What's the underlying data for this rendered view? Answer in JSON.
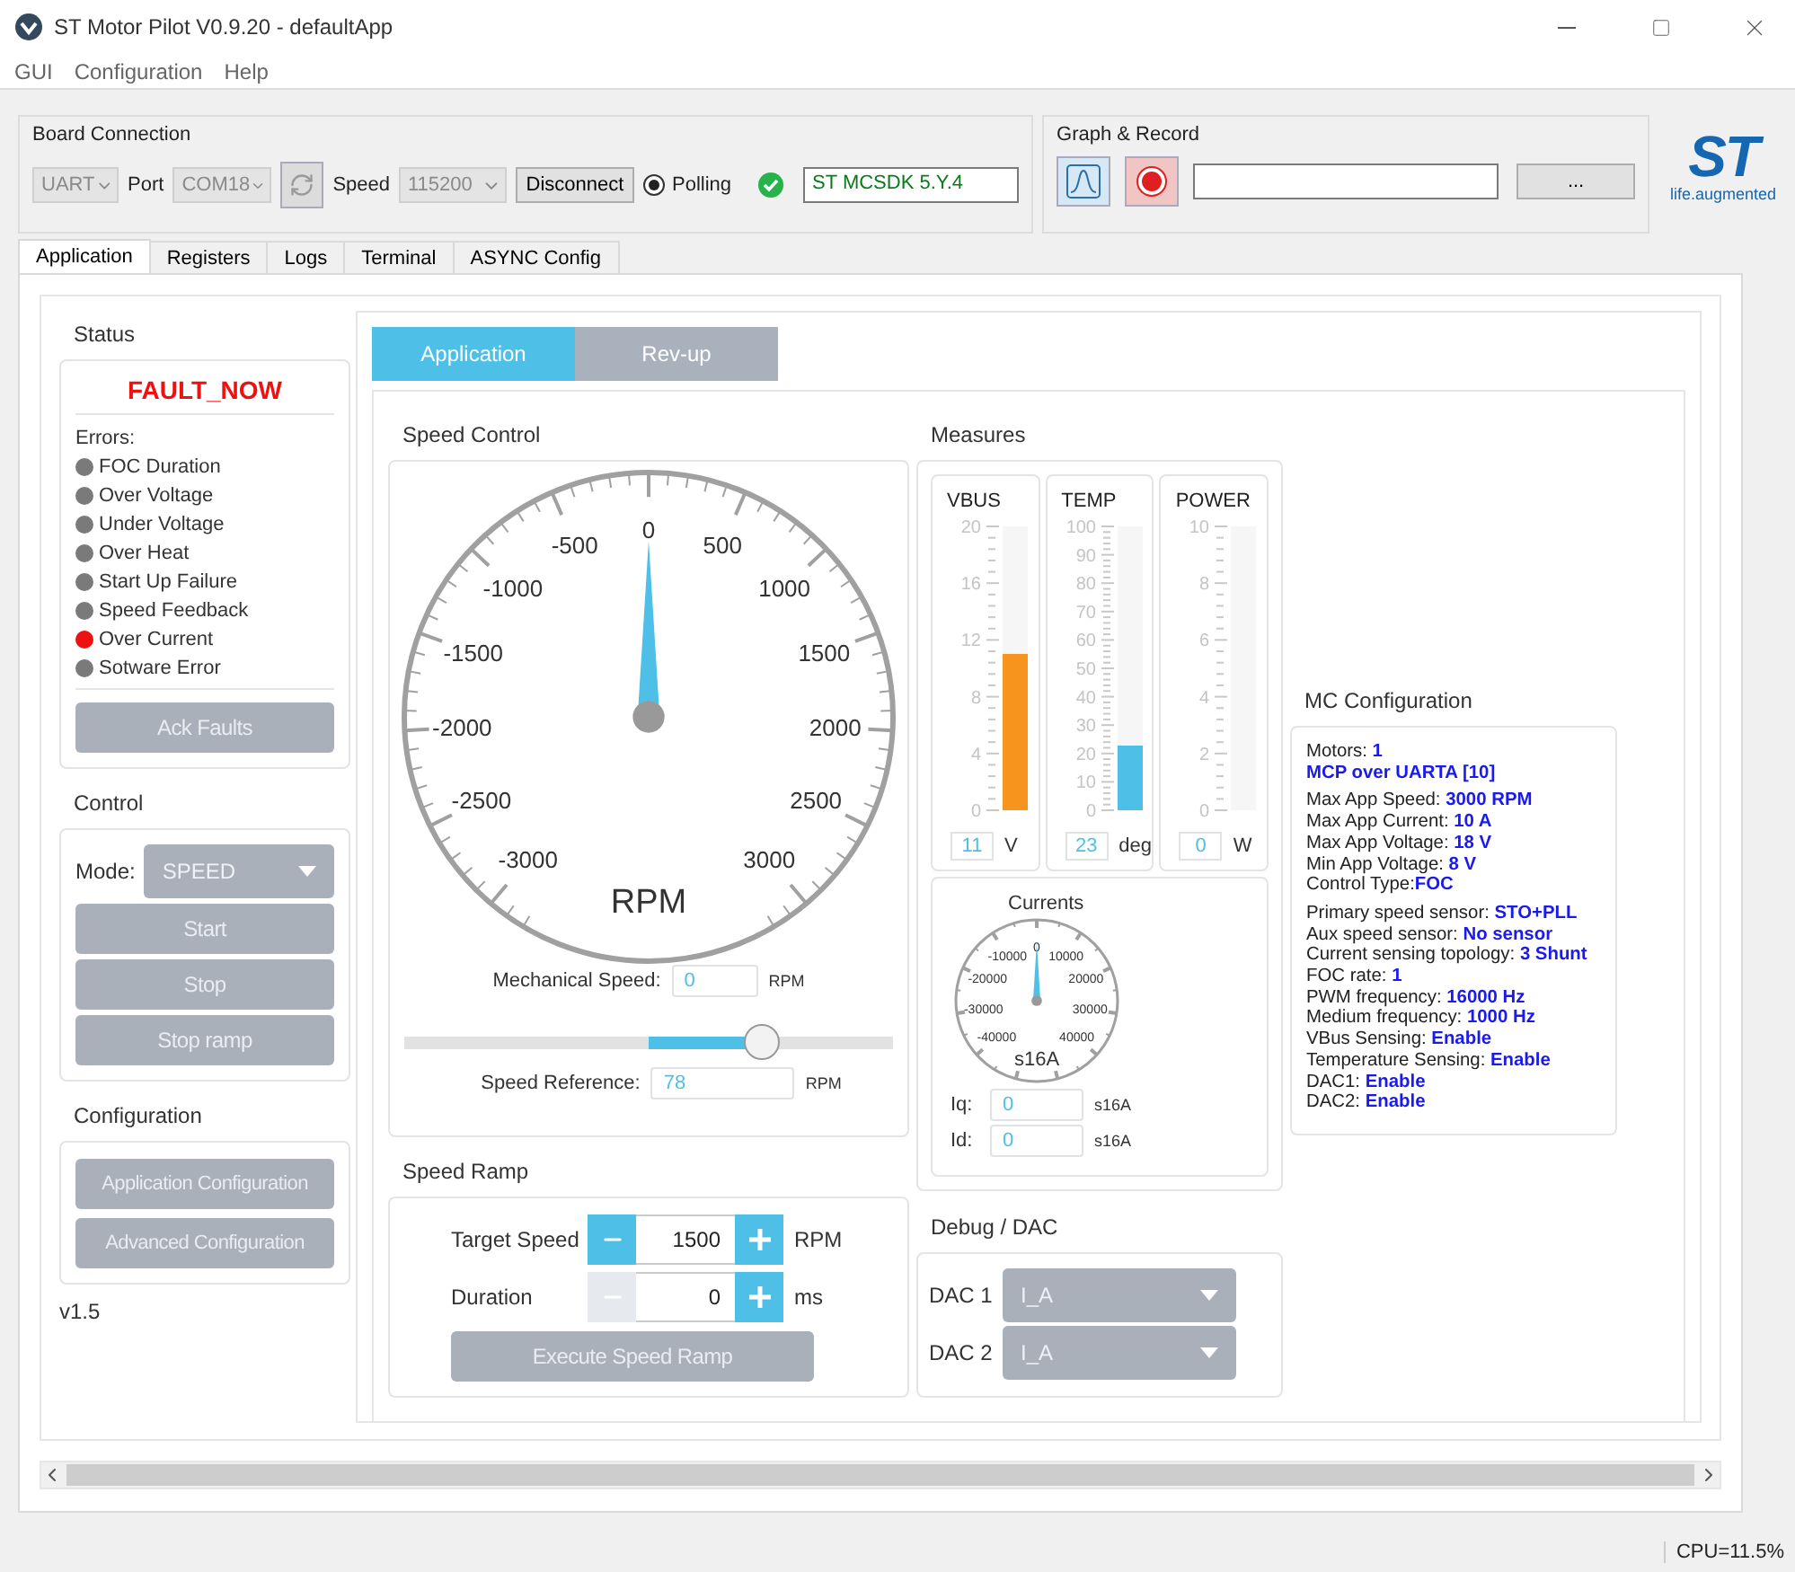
{
  "window": {
    "title": "ST Motor Pilot V0.9.20 - defaultApp"
  },
  "menu": [
    "GUI",
    "Configuration",
    "Help"
  ],
  "board_connection": {
    "title": "Board Connection",
    "interface": "UART",
    "port_label": "Port",
    "port": "COM18",
    "speed_label": "Speed",
    "speed": "115200",
    "disconnect": "Disconnect",
    "polling": {
      "label": "Polling",
      "selected": true
    },
    "firmware": "ST MCSDK 5.Y.4"
  },
  "graph_record": {
    "title": "Graph & Record",
    "browse": "..."
  },
  "logo": {
    "mark": "ST",
    "tagline": "life.augmented"
  },
  "tabs": [
    {
      "label": "Application",
      "selected": true
    },
    {
      "label": "Registers",
      "selected": false
    },
    {
      "label": "Logs",
      "selected": false
    },
    {
      "label": "Terminal",
      "selected": false
    },
    {
      "label": "ASYNC Config",
      "selected": false
    }
  ],
  "status": {
    "title": "Status",
    "state": "FAULT_NOW",
    "errors_label": "Errors:",
    "errors": [
      {
        "name": "FOC Duration",
        "on": false
      },
      {
        "name": "Over Voltage",
        "on": false
      },
      {
        "name": "Under Voltage",
        "on": false
      },
      {
        "name": "Over Heat",
        "on": false
      },
      {
        "name": "Start Up Failure",
        "on": false
      },
      {
        "name": "Speed Feedback",
        "on": false
      },
      {
        "name": "Over Current",
        "on": true
      },
      {
        "name": "Sotware Error",
        "on": false
      }
    ],
    "ack": "Ack Faults"
  },
  "control": {
    "title": "Control",
    "mode_label": "Mode:",
    "mode": "SPEED",
    "buttons": [
      "Start",
      "Stop",
      "Stop ramp"
    ]
  },
  "configuration": {
    "title": "Configuration",
    "buttons": [
      "Application Configuration",
      "Advanced Configuration"
    ]
  },
  "version": "v1.5",
  "inner_tabs": [
    {
      "label": "Application",
      "selected": true
    },
    {
      "label": "Rev-up",
      "selected": false
    }
  ],
  "speed_control": {
    "title": "Speed Control",
    "gauge": {
      "labels": [
        "-3000",
        "-2500",
        "-2000",
        "-1500",
        "-1000",
        "-500",
        "0",
        "500",
        "1000",
        "1500",
        "2000",
        "2500",
        "3000"
      ],
      "unit": "RPM",
      "level": 0.5
    },
    "mechanical_speed": {
      "label": "Mechanical Speed:",
      "value": "0",
      "unit": "RPM"
    },
    "slider": {
      "level": 0.73
    },
    "speed_reference": {
      "label": "Speed Reference:",
      "value": "78",
      "unit": "RPM"
    }
  },
  "speed_ramp": {
    "title": "Speed Ramp",
    "steppers": [
      {
        "label": "Target Speed",
        "value": "1500",
        "unit": "RPM",
        "minus_disabled": false
      },
      {
        "label": "Duration",
        "value": "0",
        "unit": "ms",
        "minus_disabled": true
      }
    ],
    "execute": "Execute Speed Ramp"
  },
  "measures": {
    "title": "Measures",
    "meters": [
      {
        "name": "VBUS",
        "scale": [
          "20",
          "16",
          "12",
          "8",
          "4",
          "0"
        ],
        "level": 0.55,
        "color": "#f7941d",
        "value": "11",
        "unit": "V"
      },
      {
        "name": "TEMP",
        "scale": [
          "100",
          "90",
          "80",
          "70",
          "60",
          "50",
          "40",
          "30",
          "20",
          "10",
          "0"
        ],
        "level": 0.23,
        "color": "#4ec0e8",
        "value": "23",
        "unit": "deg"
      },
      {
        "name": "POWER",
        "scale": [
          "10",
          "8",
          "6",
          "4",
          "2",
          "0"
        ],
        "level": 0,
        "value": "0",
        "unit": "W"
      }
    ],
    "currents": {
      "title": "Currents",
      "gauge": {
        "labels": [
          "0",
          "-10000",
          "10000",
          "-20000",
          "20000",
          "-30000",
          "30000",
          "-40000",
          "40000"
        ],
        "unit": "s16A",
        "level": 0.5
      },
      "rows": [
        {
          "label": "Iq:",
          "value": "0",
          "unit": "s16A"
        },
        {
          "label": "Id:",
          "value": "0",
          "unit": "s16A"
        }
      ]
    }
  },
  "debug_dac": {
    "title": "Debug / DAC",
    "rows": [
      {
        "label": "DAC 1",
        "value": "I_A"
      },
      {
        "label": "DAC 2",
        "value": "I_A"
      }
    ]
  },
  "mc_configuration": {
    "title": "MC Configuration",
    "groups": [
      [
        {
          "label": "Motors: ",
          "value": "1"
        },
        {
          "value": "MCP over UARTA [10]"
        }
      ],
      [
        {
          "label": "Max App Speed: ",
          "value": "3000 RPM"
        },
        {
          "label": "Max App Current: ",
          "value": "10 A"
        },
        {
          "label": "Max App Voltage: ",
          "value": "18 V"
        },
        {
          "label": "Min App Voltage: ",
          "value": "8 V"
        },
        {
          "label": "Control Type:",
          "value": "FOC"
        }
      ],
      [
        {
          "label": "Primary speed sensor: ",
          "value": "STO+PLL"
        },
        {
          "label": "Aux speed sensor: ",
          "value": "No sensor"
        },
        {
          "label": "Current sensing topology: ",
          "value": "3 Shunt"
        },
        {
          "label": "FOC rate: ",
          "value": "1"
        },
        {
          "label": "PWM frequency: ",
          "value": "16000 Hz"
        },
        {
          "label": "Medium frequency: ",
          "value": "1000 Hz"
        },
        {
          "label": "VBus Sensing: ",
          "value": "Enable"
        },
        {
          "label": "Temperature Sensing: ",
          "value": "Enable"
        },
        {
          "label": "DAC1: ",
          "value": "Enable"
        },
        {
          "label": "DAC2: ",
          "value": "Enable"
        }
      ]
    ]
  },
  "cpu": "CPU=11.5%"
}
